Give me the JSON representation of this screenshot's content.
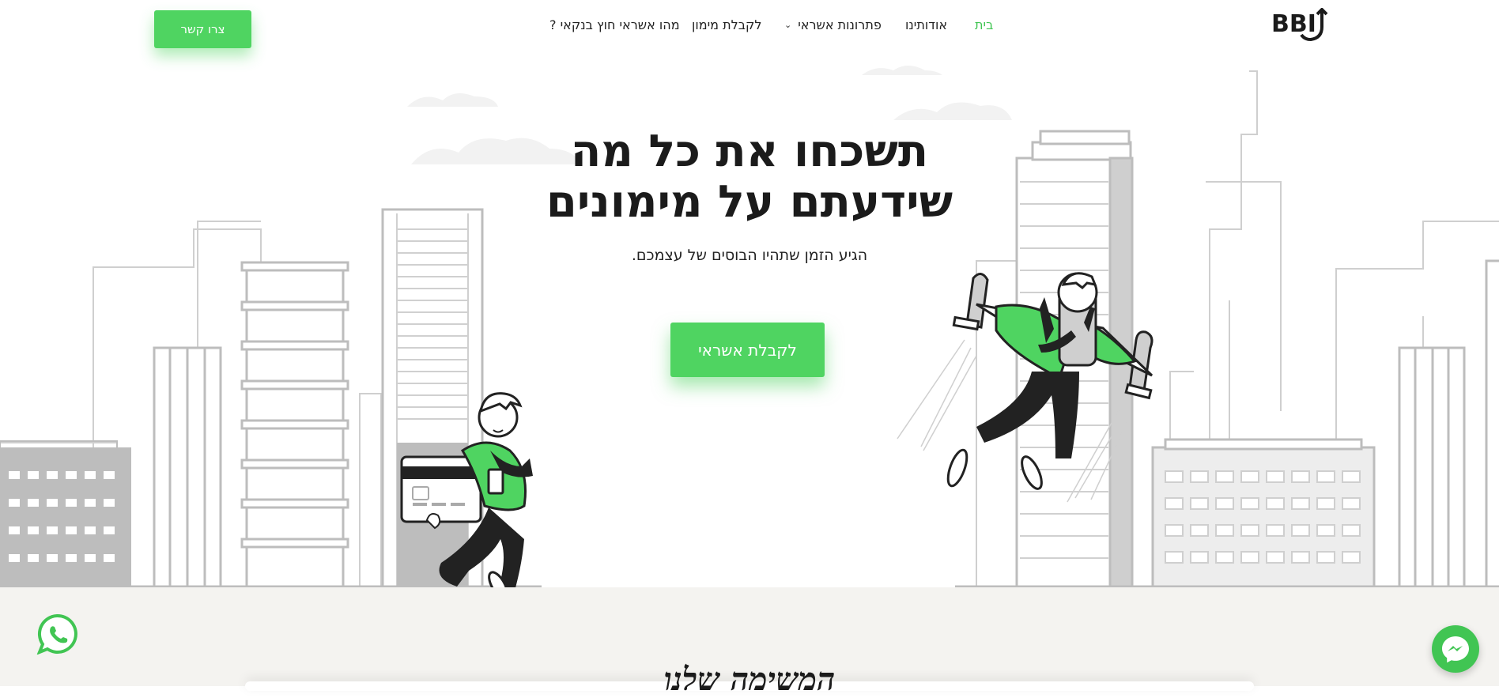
{
  "brand": {
    "logo_text": "BBI"
  },
  "nav": {
    "items": [
      {
        "label": "בית",
        "active": true
      },
      {
        "label": "אודותינו",
        "active": false
      },
      {
        "label": "פתרונות אשראי",
        "active": false,
        "dropdown": true
      },
      {
        "label": "לקבלת מימון",
        "active": false
      },
      {
        "label": "מהו אשראי חוץ בנקאי ?",
        "active": false
      }
    ],
    "contact_button": "צרו קשר"
  },
  "hero": {
    "title_line1": "תשכחו את כל מה",
    "title_line2": "שידעתם על מימונים",
    "subtitle": "הגיע הזמן שתהיו הבוסים של עצמכם.",
    "cta_button": "לקבלת אשראי"
  },
  "section": {
    "heading": "המשימה שלנו"
  },
  "floating": {
    "whatsapp": "whatsapp-icon",
    "messenger": "messenger-icon"
  },
  "colors": {
    "accent": "#4fd461",
    "accent_dark": "#41c553",
    "text": "#1b1b1b",
    "section_bg": "#f4f3f0",
    "line": "#c8c8c8"
  }
}
